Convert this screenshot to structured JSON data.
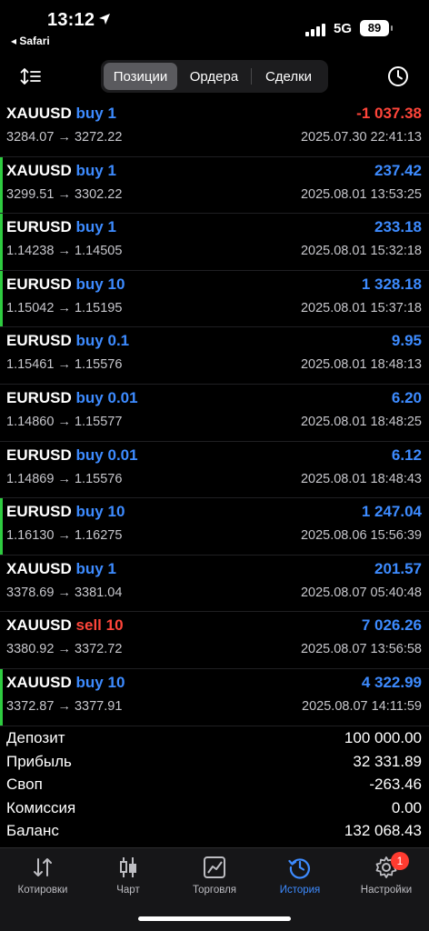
{
  "status": {
    "time": "13:12",
    "back_app": "◂ Safari",
    "network": "5G",
    "battery": "89"
  },
  "segments": [
    {
      "label": "Позиции",
      "active": true
    },
    {
      "label": "Ордера",
      "active": false
    },
    {
      "label": "Сделки",
      "active": false
    }
  ],
  "colors": {
    "buy": "#3d8bff",
    "sell": "#ff453a",
    "profit": "#3d8bff",
    "loss": "#ff453a",
    "indicator": "#2ecc40"
  },
  "deals": [
    {
      "symbol": "XAUUSD",
      "side": "buy",
      "volume": "1",
      "prices": "3284.07 → 3272.22",
      "profit": "-1 037.38",
      "loss": true,
      "datetime": "2025.07.30 22:41:13",
      "marked": false
    },
    {
      "symbol": "XAUUSD",
      "side": "buy",
      "volume": "1",
      "prices": "3299.51 → 3302.22",
      "profit": "237.42",
      "loss": false,
      "datetime": "2025.08.01 13:53:25",
      "marked": true
    },
    {
      "symbol": "EURUSD",
      "side": "buy",
      "volume": "1",
      "prices": "1.14238 → 1.14505",
      "profit": "233.18",
      "loss": false,
      "datetime": "2025.08.01 15:32:18",
      "marked": true
    },
    {
      "symbol": "EURUSD",
      "side": "buy",
      "volume": "10",
      "prices": "1.15042 → 1.15195",
      "profit": "1 328.18",
      "loss": false,
      "datetime": "2025.08.01 15:37:18",
      "marked": true
    },
    {
      "symbol": "EURUSD",
      "side": "buy",
      "volume": "0.1",
      "prices": "1.15461 → 1.15576",
      "profit": "9.95",
      "loss": false,
      "datetime": "2025.08.01 18:48:13",
      "marked": false
    },
    {
      "symbol": "EURUSD",
      "side": "buy",
      "volume": "0.01",
      "prices": "1.14860 → 1.15577",
      "profit": "6.20",
      "loss": false,
      "datetime": "2025.08.01 18:48:25",
      "marked": false
    },
    {
      "symbol": "EURUSD",
      "side": "buy",
      "volume": "0.01",
      "prices": "1.14869 → 1.15576",
      "profit": "6.12",
      "loss": false,
      "datetime": "2025.08.01 18:48:43",
      "marked": false
    },
    {
      "symbol": "EURUSD",
      "side": "buy",
      "volume": "10",
      "prices": "1.16130 → 1.16275",
      "profit": "1 247.04",
      "loss": false,
      "datetime": "2025.08.06 15:56:39",
      "marked": true
    },
    {
      "symbol": "XAUUSD",
      "side": "buy",
      "volume": "1",
      "prices": "3378.69 → 3381.04",
      "profit": "201.57",
      "loss": false,
      "datetime": "2025.08.07 05:40:48",
      "marked": false
    },
    {
      "symbol": "XAUUSD",
      "side": "sell",
      "volume": "10",
      "prices": "3380.92 → 3372.72",
      "profit": "7 026.26",
      "loss": false,
      "datetime": "2025.08.07 13:56:58",
      "marked": false
    },
    {
      "symbol": "XAUUSD",
      "side": "buy",
      "volume": "10",
      "prices": "3372.87 → 3377.91",
      "profit": "4 322.99",
      "loss": false,
      "datetime": "2025.08.07 14:11:59",
      "marked": true
    }
  ],
  "summary": [
    {
      "label": "Депозит",
      "value": "100 000.00"
    },
    {
      "label": "Прибыль",
      "value": "32 331.89"
    },
    {
      "label": "Своп",
      "value": "-263.46"
    },
    {
      "label": "Комиссия",
      "value": "0.00"
    },
    {
      "label": "Баланс",
      "value": "132 068.43"
    }
  ],
  "tabs": [
    {
      "label": "Котировки",
      "icon": "quotes-arrows-icon",
      "active": false
    },
    {
      "label": "Чарт",
      "icon": "candlestick-chart-icon",
      "active": false
    },
    {
      "label": "Торговля",
      "icon": "trade-chart-icon",
      "active": false
    },
    {
      "label": "История",
      "icon": "history-clock-icon",
      "active": true
    },
    {
      "label": "Настройки",
      "icon": "settings-gear-icon",
      "active": false,
      "badge": "1"
    }
  ]
}
